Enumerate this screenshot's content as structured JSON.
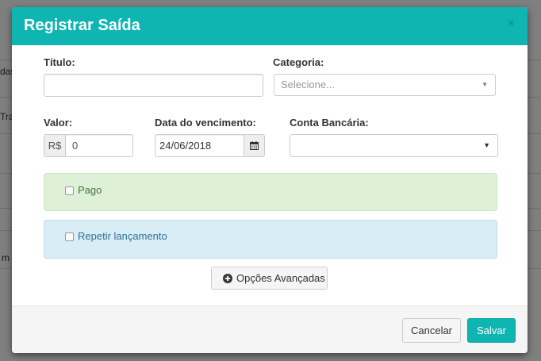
{
  "background": {
    "fragments": [
      "das",
      "Tra",
      "m"
    ]
  },
  "modal": {
    "title": "Registrar Saída",
    "close_glyph": "×",
    "fields": {
      "titulo_label": "Título:",
      "titulo_value": "",
      "categoria_label": "Categoria:",
      "categoria_placeholder": "Selecione...",
      "valor_label": "Valor:",
      "valor_prefix": "R$",
      "valor_value": "0",
      "vencimento_label": "Data do vencimento:",
      "vencimento_value": "24/06/2018",
      "conta_label": "Conta Bancária:",
      "conta_value": ""
    },
    "pago_label": "Pago",
    "pago_checked": false,
    "repetir_label": "Repetir lançamento",
    "repetir_checked": false,
    "advanced_label": "Opções Avançadas",
    "footer": {
      "cancel_label": "Cancelar",
      "save_label": "Salvar"
    }
  },
  "colors": {
    "header": "#0fb5b0",
    "success_bg": "#dff0d8",
    "success_text": "#3c763d",
    "info_bg": "#d9edf7",
    "info_text": "#31708f",
    "primary_button": "#0fb5b0"
  },
  "icons": {
    "calendar": "calendar-icon",
    "plus_circle": "plus-circle-icon",
    "close": "close-icon",
    "dropdown": "chevron-down-icon"
  }
}
